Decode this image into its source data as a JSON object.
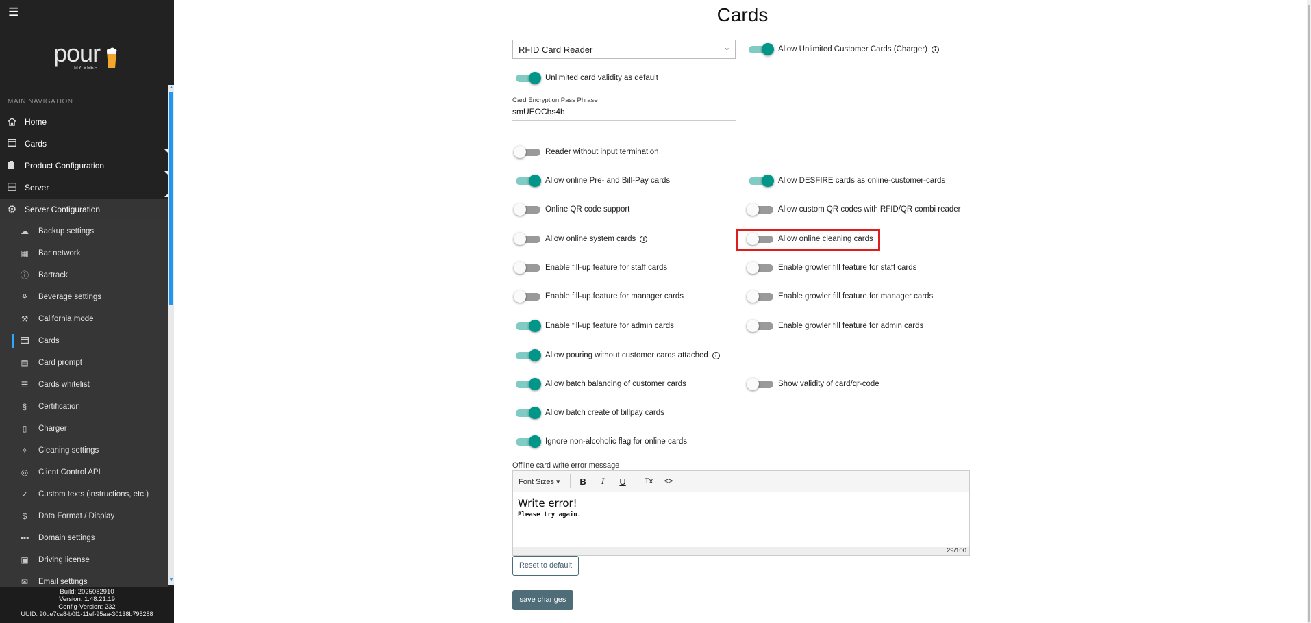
{
  "sidebar": {
    "menu_icon": "☰",
    "logo": {
      "text": "pour",
      "subtext": "MY BEER"
    },
    "nav_header": "MAIN NAVIGATION",
    "items": [
      {
        "label": "Home",
        "icon": "home-icon"
      },
      {
        "label": "Cards",
        "icon": "card-icon"
      },
      {
        "label": "Product Configuration",
        "icon": "bottle-icon"
      },
      {
        "label": "Server",
        "icon": "server-icon"
      },
      {
        "label": "Server Configuration",
        "icon": "gear-icon"
      }
    ],
    "sub_items": [
      {
        "label": "Backup settings",
        "icon": "cloud-icon"
      },
      {
        "label": "Bar network",
        "icon": "network-icon"
      },
      {
        "label": "Bartrack",
        "icon": "info-circle-icon"
      },
      {
        "label": "Beverage settings",
        "icon": "tap-icon"
      },
      {
        "label": "California mode",
        "icon": "gavel-icon"
      },
      {
        "label": "Cards",
        "icon": "card-icon"
      },
      {
        "label": "Card prompt",
        "icon": "message-icon"
      },
      {
        "label": "Cards whitelist",
        "icon": "list-icon"
      },
      {
        "label": "Certification",
        "icon": "section-icon"
      },
      {
        "label": "Charger",
        "icon": "tablet-icon"
      },
      {
        "label": "Cleaning settings",
        "icon": "sparkle-icon"
      },
      {
        "label": "Client Control API",
        "icon": "fingerprint-icon"
      },
      {
        "label": "Custom texts (instructions, etc.)",
        "icon": "check-icon"
      },
      {
        "label": "Data Format / Display",
        "icon": "dollar-icon"
      },
      {
        "label": "Domain settings",
        "icon": "dots-icon"
      },
      {
        "label": "Driving license",
        "icon": "id-card-icon"
      },
      {
        "label": "Email settings",
        "icon": "mail-icon"
      }
    ],
    "footer": {
      "build": "Build: 2025082910",
      "version": "Version: 1.48.21.19",
      "config_version": "Config-Version: 232",
      "uuid": "UUID: 90de7ca8-b0f1-11ef-95aa-30138b795288"
    }
  },
  "main": {
    "title": "Cards",
    "reader_select": "RFID Card Reader",
    "passphrase": {
      "label": "Card Encryption Pass Phrase",
      "value": "smUEOChs4h"
    },
    "toggles": {
      "allow_unlimited": {
        "label": "Allow Unlimited Customer Cards (Charger)",
        "on": true
      },
      "unlimited_validity": {
        "label": "Unlimited card validity as default",
        "on": true
      },
      "reader_no_term": {
        "label": "Reader without input termination",
        "on": false
      },
      "online_prebill": {
        "label": "Allow online Pre- and Bill-Pay cards",
        "on": true
      },
      "desfire": {
        "label": "Allow DESFIRE cards as online-customer-cards",
        "on": true
      },
      "qr_support": {
        "label": "Online QR code support",
        "on": false
      },
      "custom_qr": {
        "label": "Allow custom QR codes with RFID/QR combi reader",
        "on": false
      },
      "system_cards": {
        "label": "Allow online system cards",
        "on": false
      },
      "cleaning_cards": {
        "label": "Allow online cleaning cards",
        "on": false
      },
      "fillup_staff": {
        "label": "Enable fill-up feature for staff cards",
        "on": false
      },
      "growler_staff": {
        "label": "Enable growler fill feature for staff cards",
        "on": false
      },
      "fillup_manager": {
        "label": "Enable fill-up feature for manager cards",
        "on": false
      },
      "growler_manager": {
        "label": "Enable growler fill feature for manager cards",
        "on": false
      },
      "fillup_admin": {
        "label": "Enable fill-up feature for admin cards",
        "on": true
      },
      "growler_admin": {
        "label": "Enable growler fill feature for admin cards",
        "on": false
      },
      "pouring_without": {
        "label": "Allow pouring without customer cards attached",
        "on": true
      },
      "batch_balancing": {
        "label": "Allow batch balancing of customer cards",
        "on": true
      },
      "show_validity": {
        "label": "Show validity of card/qr-code",
        "on": false
      },
      "batch_create": {
        "label": "Allow batch create of billpay cards",
        "on": true
      },
      "ignore_nonalc": {
        "label": "Ignore non-alcoholic flag for online cards",
        "on": true
      }
    },
    "editor": {
      "label": "Offline card write error message",
      "font_sizes": "Font Sizes",
      "bold": "B",
      "italic": "I",
      "underline": "U",
      "clear_format": "Tx",
      "code": "<>",
      "line1": "Write error!",
      "line2": "Please try again.",
      "counter": "29/100"
    },
    "reset_button": "Reset to default",
    "save_button": "save changes"
  },
  "colors": {
    "accent": "#009688",
    "highlight": "#e21b1b",
    "sidebar_bg": "#222222"
  }
}
